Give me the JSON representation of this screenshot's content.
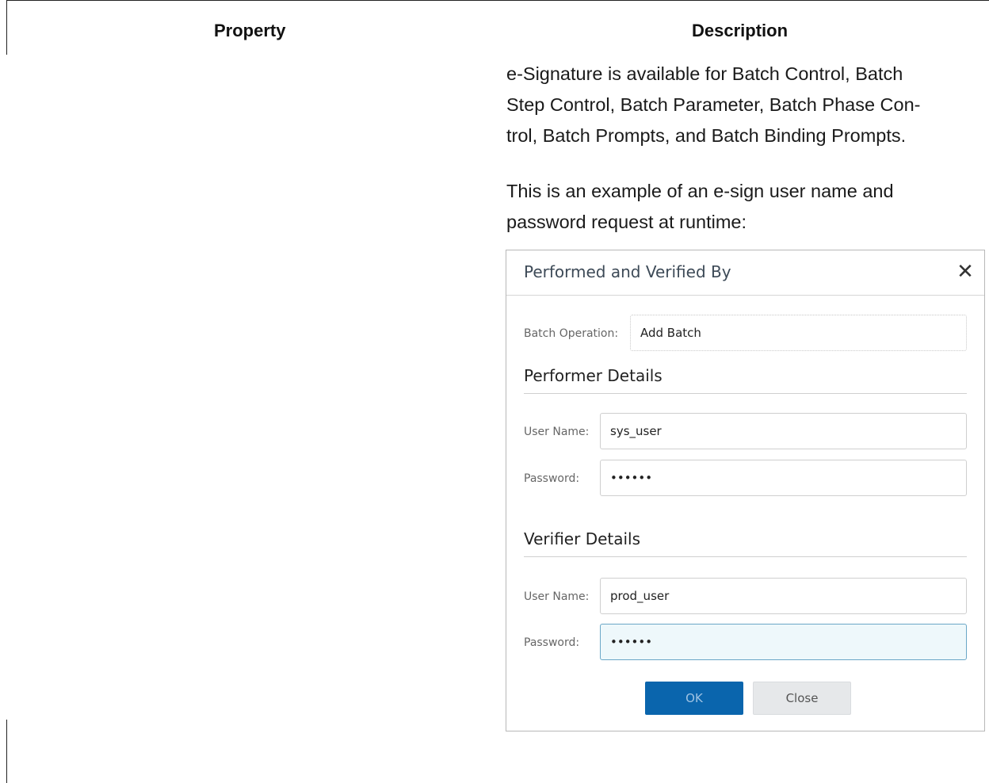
{
  "table": {
    "headers": [
      "Property",
      "Description"
    ]
  },
  "description": {
    "paragraph1_lines": [
      "e-Signature is available for Batch Control, Batch",
      "Step Control, Batch Parameter, Batch Phase Con-",
      "trol, Batch Prompts, and Batch Binding Prompts."
    ],
    "paragraph2_lines": [
      "This is an example of an e-sign user name and",
      "password request at runtime:"
    ]
  },
  "dialog": {
    "title": "Performed and Verified By",
    "close_glyph": "✕",
    "batch_operation": {
      "label": "Batch Operation:",
      "value": "Add Batch"
    },
    "performer": {
      "section_title": "Performer Details",
      "user_name": {
        "label": "User Name:",
        "value": "sys_user"
      },
      "password": {
        "label": "Password:",
        "value": "••••••"
      }
    },
    "verifier": {
      "section_title": "Verifier Details",
      "user_name": {
        "label": "User Name:",
        "value": "prod_user"
      },
      "password": {
        "label": "Password:",
        "value": "••••••"
      }
    },
    "buttons": {
      "ok": "OK",
      "close": "Close"
    }
  }
}
